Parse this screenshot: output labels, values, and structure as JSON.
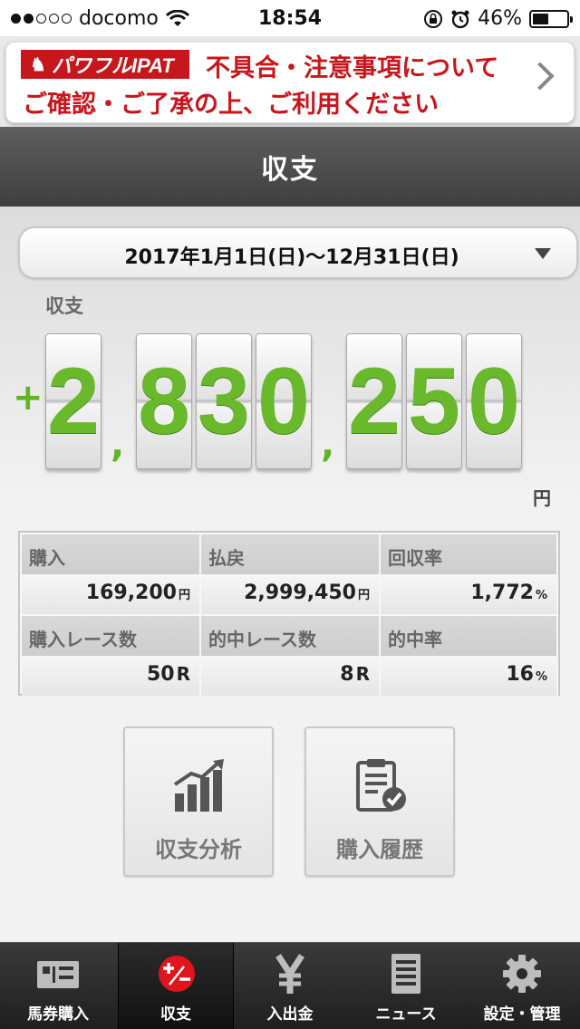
{
  "status_bar": {
    "carrier": "docomo",
    "time": "18:54",
    "battery": "46%",
    "battery_level": 0.46
  },
  "banner": {
    "logo": "パワフルIPAT",
    "line1": "不具合・注意事項について",
    "line2": "ご確認・ご了承の上、ご利用ください"
  },
  "header": {
    "title": "収支"
  },
  "date_range": {
    "text": "2017年1月1日(日)〜12月31日(日)"
  },
  "balance": {
    "label": "収支",
    "sign": "+",
    "digits": [
      "2",
      "8",
      "3",
      "0",
      "2",
      "5",
      "0"
    ],
    "separator": ",",
    "unit": "円",
    "color": "#6ab92d"
  },
  "stats": {
    "purchase": {
      "label": "購入",
      "value": "169,200",
      "unit": "円"
    },
    "payout": {
      "label": "払戻",
      "value": "2,999,450",
      "unit": "円"
    },
    "recovery_rate": {
      "label": "回収率",
      "value": "1,772",
      "unit": "%"
    },
    "races": {
      "label": "購入レース数",
      "value": "50",
      "unit": "R"
    },
    "hit_races": {
      "label": "的中レース数",
      "value": "8",
      "unit": "R"
    },
    "hit_rate": {
      "label": "的中率",
      "value": "16",
      "unit": "%"
    }
  },
  "actions": {
    "analysis": {
      "label": "収支分析",
      "icon": "bar-chart-trend-icon"
    },
    "history": {
      "label": "購入履歴",
      "icon": "clipboard-check-icon"
    }
  },
  "tabs": [
    {
      "label": "馬券購入",
      "icon": "ticket-icon"
    },
    {
      "label": "収支",
      "icon": "plus-minus-icon",
      "active": true,
      "accent": "#e0141c"
    },
    {
      "label": "入出金",
      "icon": "yen-icon"
    },
    {
      "label": "ニュース",
      "icon": "news-icon"
    },
    {
      "label": "設定・管理",
      "icon": "gear-icon"
    }
  ]
}
